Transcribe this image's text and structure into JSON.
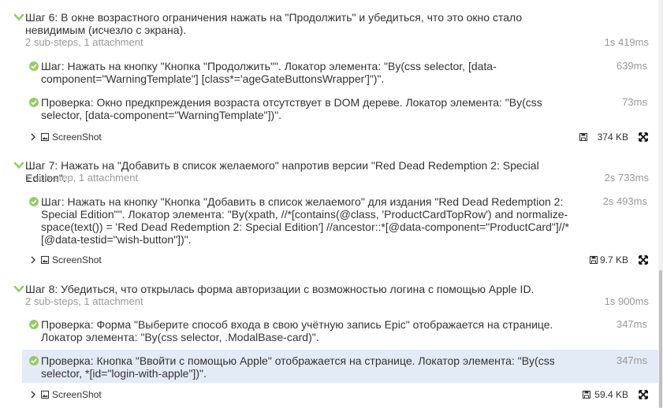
{
  "steps": [
    {
      "title": "Шаг 6: В окне возрастного ограничения нажать на \"Продолжить\" и убедиться, что это окно стало невидимым (исчезло с экрана).",
      "meta": "2 sub-steps, 1 attachment",
      "duration": "1s 419ms",
      "substeps": [
        {
          "text": "Шаг: Нажать на кнопку \"Кнопка \"Продолжить\"\". Локатор элемента: \"By(css selector, [data-component=\"WarningTemplate\"] [class*='ageGateButtonsWrapper']\")\".",
          "duration": "639ms"
        },
        {
          "text": "Проверка: Окно предкпреждения возраста отсутствует в DOM дереве. Локатор элемента: \"By(css selector, [data-component=\"WarningTemplate\"])\".",
          "duration": "73ms"
        }
      ],
      "attachment": {
        "name": "ScreenShot",
        "size": "374 KB"
      }
    },
    {
      "title": "Шаг 7: Нажать на \"Добавить в список желаемого\" напротив версии \"Red Dead Redemption 2: Special Edition\".",
      "meta": "1 sub-step, 1 attachment",
      "duration": "2s 733ms",
      "substeps": [
        {
          "text": "Шаг: Нажать на кнопку \"Кнопка \"Добавить в список желаемого\" для издания \"Red Dead Redemption 2: Special Edition\"\". Локатор элемента: \"By(xpath, //*[contains(@class, 'ProductCardTopRow') and normalize-space(text()) = 'Red Dead Redemption 2: Special Edition'] //ancestor::*[@data-component=\"ProductCard\"]//*[@data-testid=\"wish-button\"])\".",
          "duration": "2s 493ms"
        }
      ],
      "attachment": {
        "name": "ScreenShot",
        "size": "9.7 KB"
      }
    },
    {
      "title": "Шаг 8: Убедиться, что открылась форма авторизации с возможностью логина с помощью Apple ID.",
      "meta": "2 sub-steps, 1 attachment",
      "duration": "1s 900ms",
      "substeps": [
        {
          "text": "Проверка: Форма \"Выберите способ входа в свою учётную запись Epic\" отображается на странице. Локатор элемента: \"By(css selector, .ModalBase-card)\".",
          "duration": "347ms"
        },
        {
          "text": "Проверка: Кнопка \"Ввойти с помощью Apple\" отображается на странице. Локатор элемента: \"By(css selector, *[id=\"login-with-apple\"])\".",
          "duration": "347ms"
        }
      ],
      "attachment": {
        "name": "ScreenShot",
        "size": "59.4 KB"
      }
    }
  ],
  "colors": {
    "check": "#97cc64",
    "chevron": "#97cc64",
    "highlight": "#e3ebf7",
    "muted": "#999999"
  },
  "icons": {
    "step": "chevron-down-icon",
    "passed": "check-circle-icon",
    "attachment": "image-icon",
    "size": "floppy-disk-icon",
    "expand": "expand-icon"
  }
}
